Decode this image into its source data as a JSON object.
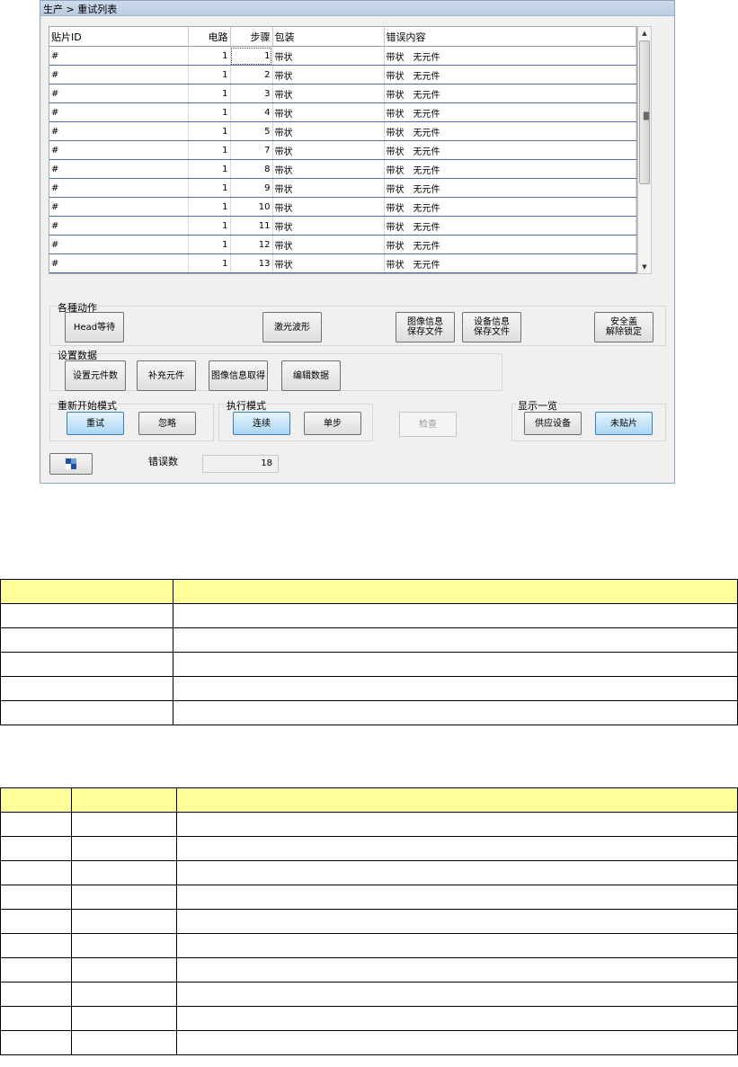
{
  "window": {
    "title": "生产 > 重试列表"
  },
  "grid": {
    "columns": [
      "贴片ID",
      "电路",
      "步骤",
      "包装",
      "错误内容"
    ],
    "rows": [
      [
        "#",
        "1",
        "1",
        "带状",
        "带状　无元件"
      ],
      [
        "#",
        "1",
        "2",
        "带状",
        "带状　无元件"
      ],
      [
        "#",
        "1",
        "3",
        "带状",
        "带状　无元件"
      ],
      [
        "#",
        "1",
        "4",
        "带状",
        "带状　无元件"
      ],
      [
        "#",
        "1",
        "5",
        "带状",
        "带状　无元件"
      ],
      [
        "#",
        "1",
        "7",
        "带状",
        "带状　无元件"
      ],
      [
        "#",
        "1",
        "8",
        "带状",
        "带状　无元件"
      ],
      [
        "#",
        "1",
        "9",
        "带状",
        "带状　无元件"
      ],
      [
        "#",
        "1",
        "10",
        "带状",
        "带状　无元件"
      ],
      [
        "#",
        "1",
        "11",
        "带状",
        "带状　无元件"
      ],
      [
        "#",
        "1",
        "12",
        "带状",
        "带状　无元件"
      ],
      [
        "#",
        "1",
        "13",
        "带状",
        "带状　无元件"
      ]
    ]
  },
  "actions": {
    "label": "各種动作",
    "head_wait": "Head等待",
    "laser_wave": "激光波形",
    "image_save_1": "图像信息",
    "image_save_2": "保存文件",
    "device_save_1": "设备信息",
    "device_save_2": "保存文件",
    "safety_1": "安全盖",
    "safety_2": "解除锁定"
  },
  "settings": {
    "label": "设置数据",
    "set_count": "设置元件数",
    "supplement": "补充元件",
    "image_get": "图像信息取得",
    "edit_data": "编辑数据"
  },
  "restart": {
    "label": "重新开始模式",
    "retry": "重试",
    "ignore": "忽略"
  },
  "exec": {
    "label": "执行模式",
    "continuous": "连续",
    "single": "单步"
  },
  "check": "检查",
  "display": {
    "label": "显示一览",
    "supply": "供应设备",
    "unmounted": "未贴片"
  },
  "error_count": {
    "label": "错误数",
    "value": "18"
  }
}
